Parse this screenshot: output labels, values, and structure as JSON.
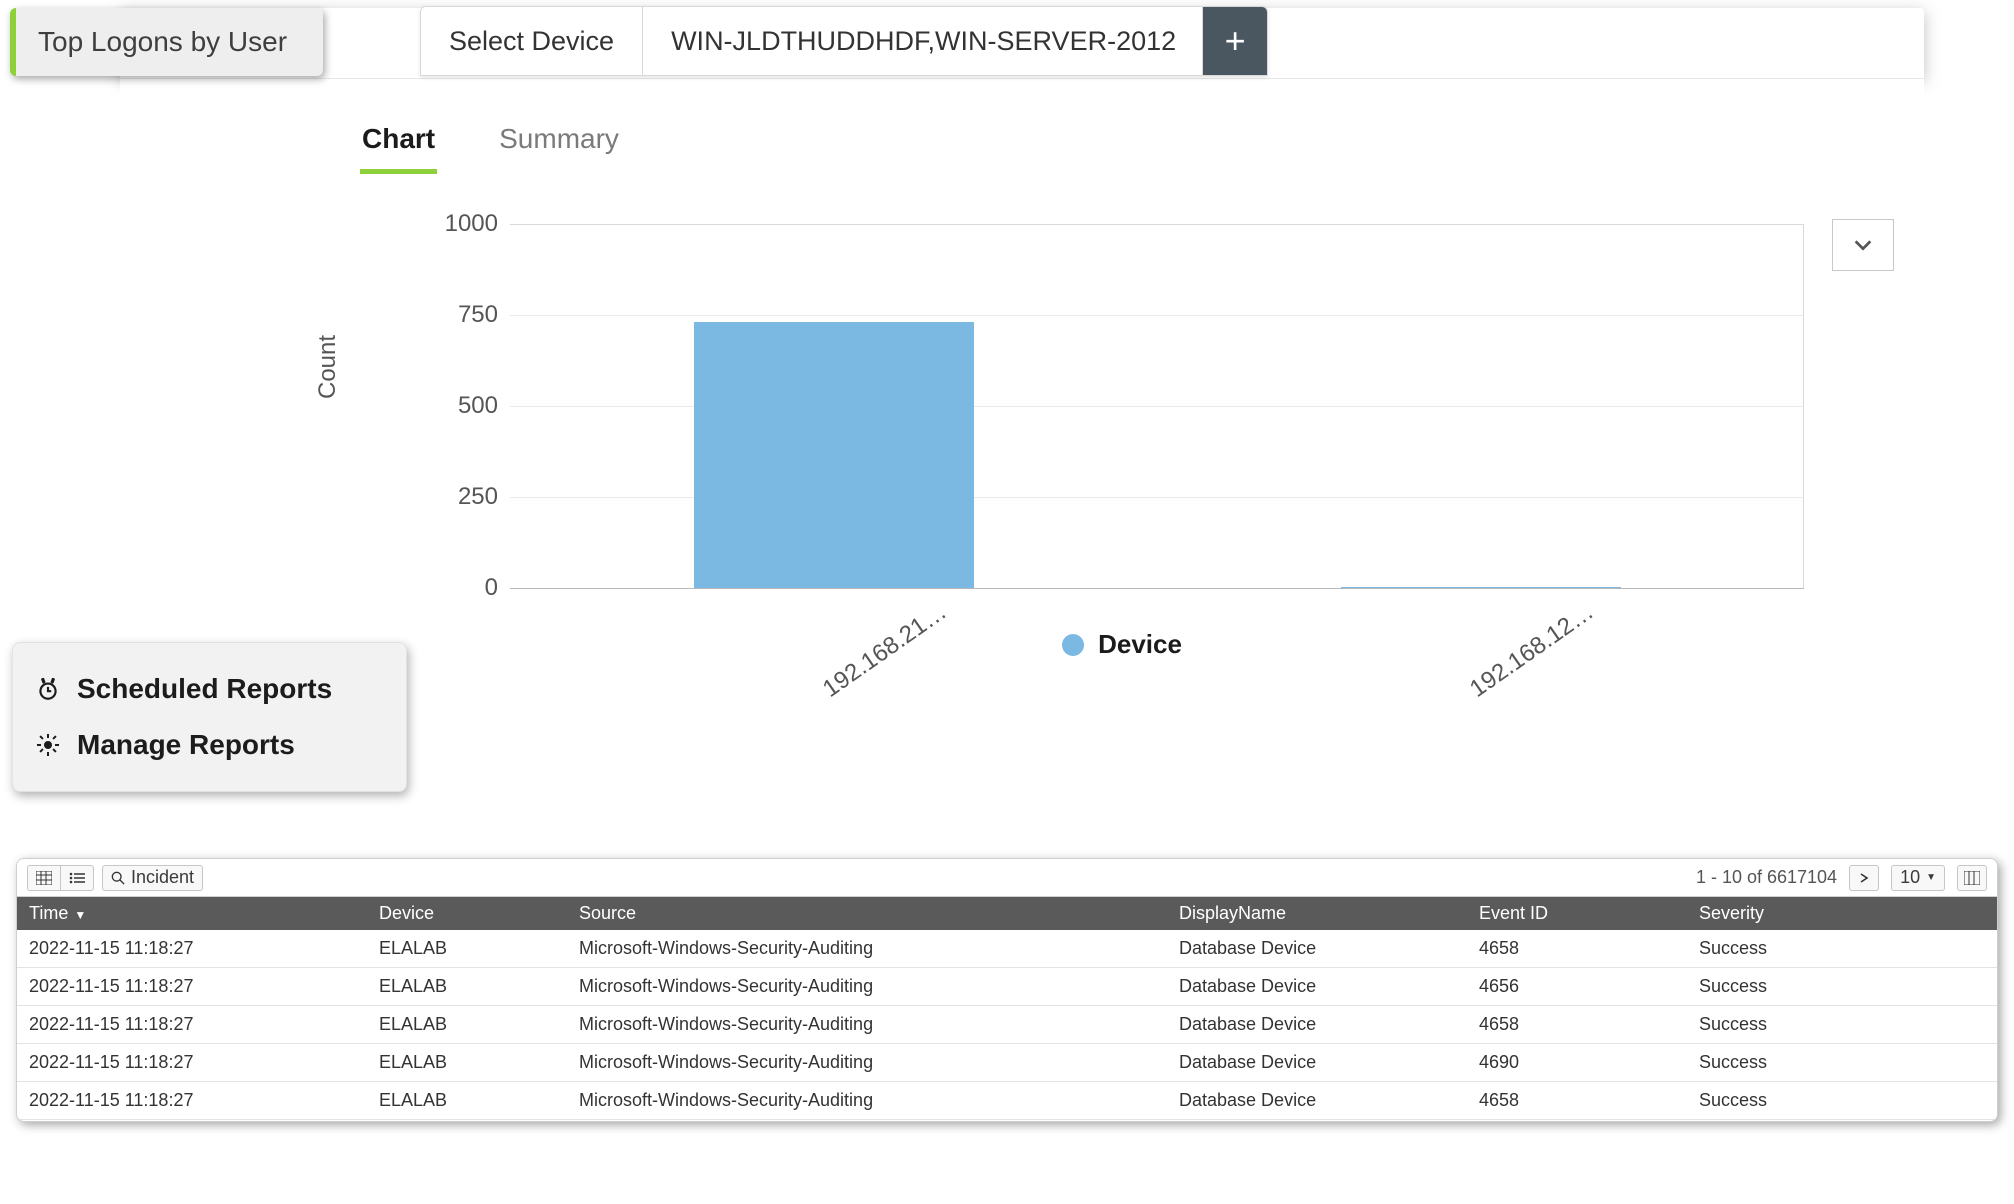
{
  "header": {
    "pill_title": "Top Logons by User",
    "select_device_label": "Select Device",
    "device_value": "WIN-JLDTHUDDHDF,WIN-SERVER-2012",
    "add_label": "+"
  },
  "subtabs": {
    "chart": "Chart",
    "summary": "Summary"
  },
  "popover": {
    "scheduled": "Scheduled Reports",
    "manage": "Manage Reports"
  },
  "toolbar": {
    "incident": "Incident",
    "paging": "1 - 10 of 6617104",
    "page_size": "10"
  },
  "table": {
    "columns": {
      "time": "Time",
      "device": "Device",
      "source": "Source",
      "display": "DisplayName",
      "event": "Event ID",
      "severity": "Severity"
    },
    "rows": [
      {
        "time": "2022-11-15 11:18:27",
        "device": "ELALAB",
        "source": "Microsoft-Windows-Security-Auditing",
        "display": "Database Device",
        "event": "4658",
        "severity": "Success"
      },
      {
        "time": "2022-11-15 11:18:27",
        "device": "ELALAB",
        "source": "Microsoft-Windows-Security-Auditing",
        "display": "Database Device",
        "event": "4656",
        "severity": "Success"
      },
      {
        "time": "2022-11-15 11:18:27",
        "device": "ELALAB",
        "source": "Microsoft-Windows-Security-Auditing",
        "display": "Database Device",
        "event": "4658",
        "severity": "Success"
      },
      {
        "time": "2022-11-15 11:18:27",
        "device": "ELALAB",
        "source": "Microsoft-Windows-Security-Auditing",
        "display": "Database Device",
        "event": "4690",
        "severity": "Success"
      },
      {
        "time": "2022-11-15 11:18:27",
        "device": "ELALAB",
        "source": "Microsoft-Windows-Security-Auditing",
        "display": "Database Device",
        "event": "4658",
        "severity": "Success"
      }
    ]
  },
  "chart_data": {
    "type": "bar",
    "title": "",
    "ylabel": "Count",
    "xlabel": "",
    "ylim": [
      0,
      1000
    ],
    "yticks": [
      0,
      250,
      500,
      750,
      1000
    ],
    "categories": [
      "192.168.21…",
      "192.168.12…"
    ],
    "series": [
      {
        "name": "Device",
        "values": [
          730,
          1
        ]
      }
    ],
    "legend": [
      "Device"
    ],
    "colors": {
      "Device": "#7bb9e3"
    }
  }
}
